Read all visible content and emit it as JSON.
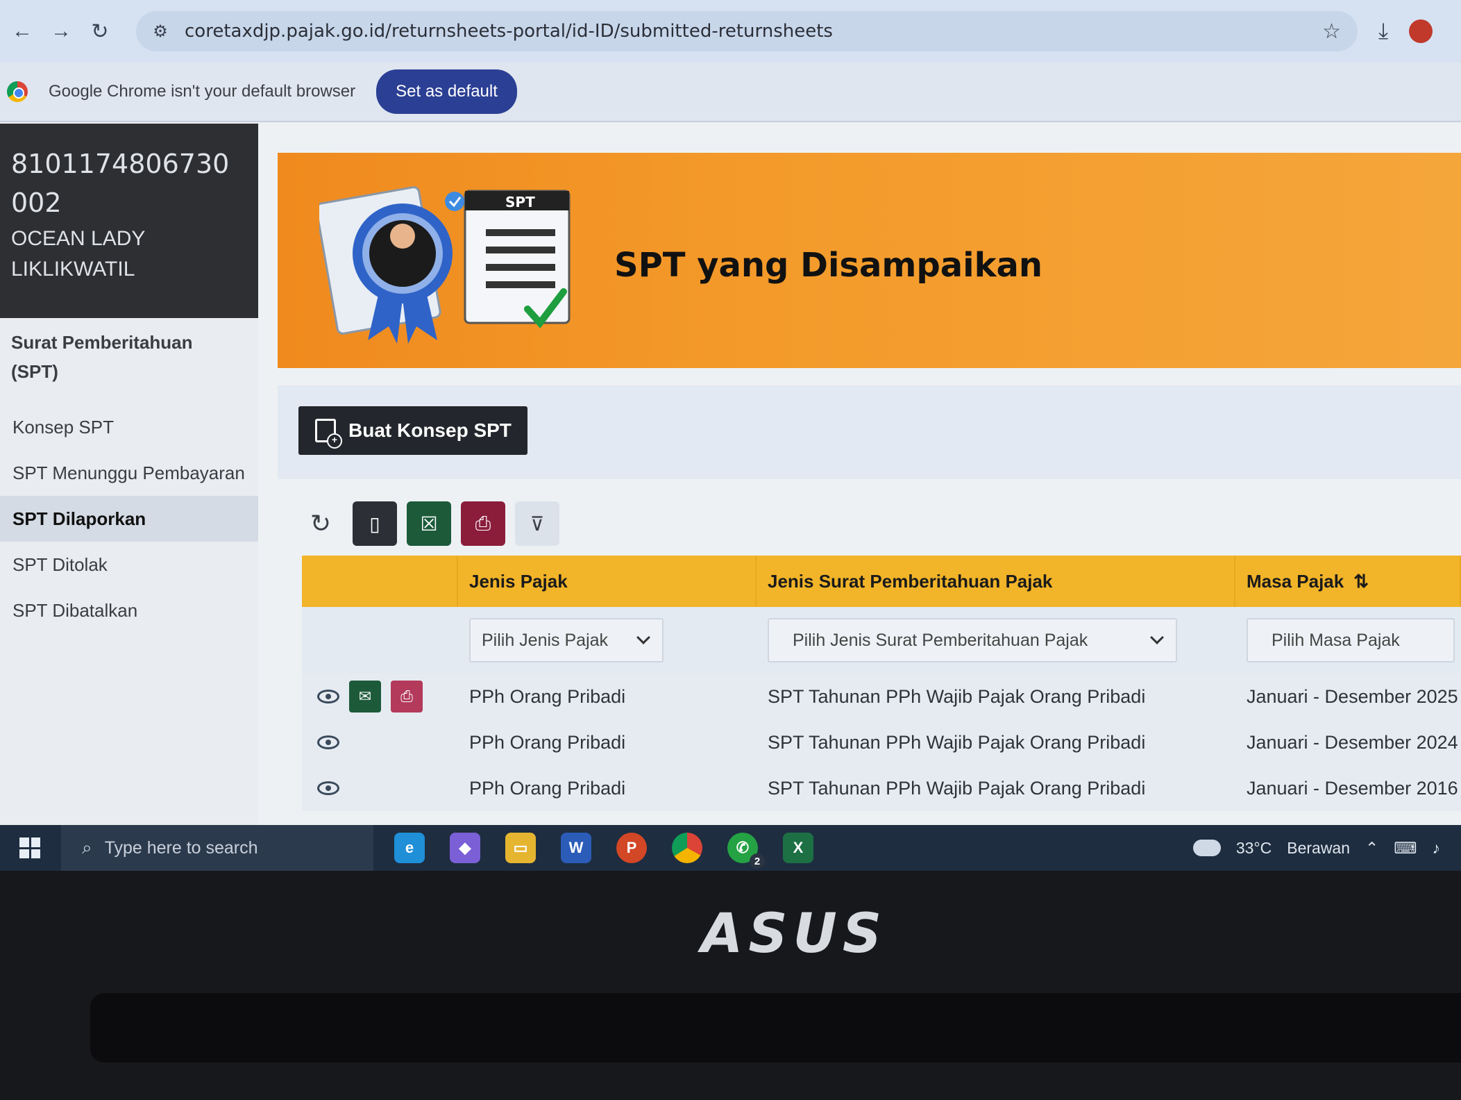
{
  "browser": {
    "url": "coretaxdjp.pajak.go.id/returnsheets-portal/id-ID/submitted-returnsheets",
    "infobar_message": "Google Chrome isn't your default browser",
    "infobar_button": "Set as default"
  },
  "sidebar": {
    "npwp": "8101174806730002",
    "name": "OCEAN LADY LIKLIKWATIL",
    "section_title": "Surat Pemberitahuan (SPT)",
    "items": [
      {
        "label": "Konsep SPT",
        "active": false
      },
      {
        "label": "SPT Menunggu Pembayaran",
        "active": false
      },
      {
        "label": "SPT Dilaporkan",
        "active": true
      },
      {
        "label": "SPT Ditolak",
        "active": false
      },
      {
        "label": "SPT Dibatalkan",
        "active": false
      }
    ]
  },
  "banner": {
    "title": "SPT yang Disampaikan",
    "illustration_tag": "SPT"
  },
  "actions": {
    "create_button": "Buat Konsep SPT"
  },
  "table": {
    "headers": [
      "",
      "Jenis Pajak",
      "Jenis Surat Pemberitahuan Pajak",
      "Masa Pajak"
    ],
    "filters": [
      "Pilih Jenis Pajak",
      "Pilih Jenis Surat Pemberitahuan Pajak",
      "Pilih Masa Pajak"
    ],
    "rows": [
      {
        "jenis_pajak": "PPh Orang Pribadi",
        "jenis_spt": "SPT Tahunan PPh Wajib Pajak Orang Pribadi",
        "masa_pajak": "Januari - Desember 2025"
      },
      {
        "jenis_pajak": "PPh Orang Pribadi",
        "jenis_spt": "SPT Tahunan PPh Wajib Pajak Orang Pribadi",
        "masa_pajak": "Januari - Desember 2024"
      },
      {
        "jenis_pajak": "PPh Orang Pribadi",
        "jenis_spt": "SPT Tahunan PPh Wajib Pajak Orang Pribadi",
        "masa_pajak": "Januari - Desember 2016"
      }
    ]
  },
  "taskbar": {
    "search_placeholder": "Type here to search",
    "temperature": "33°C",
    "weather": "Berawan",
    "whatsapp_badge": "2"
  },
  "device": {
    "brand": "ASUS"
  },
  "colors": {
    "banner": "#f39a2a",
    "table_header": "#f2b428",
    "primary_button": "#23262c",
    "excel_green": "#1c5a3a",
    "pdf_red": "#8b1d3b"
  }
}
